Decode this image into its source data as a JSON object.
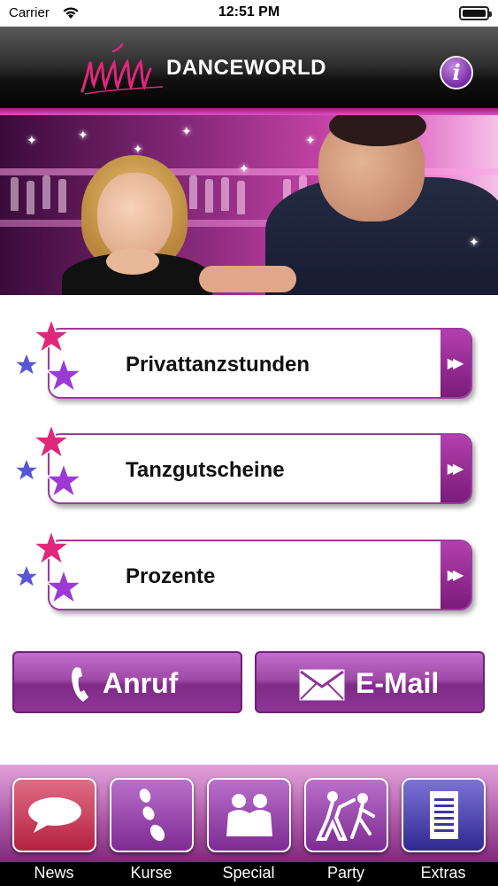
{
  "status_bar": {
    "carrier": "Carrier",
    "time": "12:51 PM"
  },
  "header": {
    "logo_text": "DANCEWORLD",
    "info_label": "i"
  },
  "menu": {
    "items": [
      {
        "label": "Privattanzstunden",
        "arrow": "▶▶"
      },
      {
        "label": "Tanzgutscheine",
        "arrow": "▶▶"
      },
      {
        "label": "Prozente",
        "arrow": "▶▶"
      }
    ]
  },
  "actions": {
    "call_label": "Anruf",
    "email_label": "E-Mail"
  },
  "tabs": [
    {
      "label": "News",
      "icon": "speech-bubble-icon",
      "color": "#c0304e"
    },
    {
      "label": "Kurse",
      "icon": "footsteps-icon",
      "color": "#8a3a9e"
    },
    {
      "label": "Special",
      "icon": "people-icon",
      "color": "#8a3a9e"
    },
    {
      "label": "Party",
      "icon": "dancing-couple-icon",
      "color": "#8a3a9e"
    },
    {
      "label": "Extras",
      "icon": "document-icon",
      "color": "#3d36a0"
    }
  ],
  "colors": {
    "accent": "#9b3a9e",
    "pink_star": "#e0287a",
    "purple_star": "#9d3ad6",
    "blue_star": "#5856d6"
  }
}
